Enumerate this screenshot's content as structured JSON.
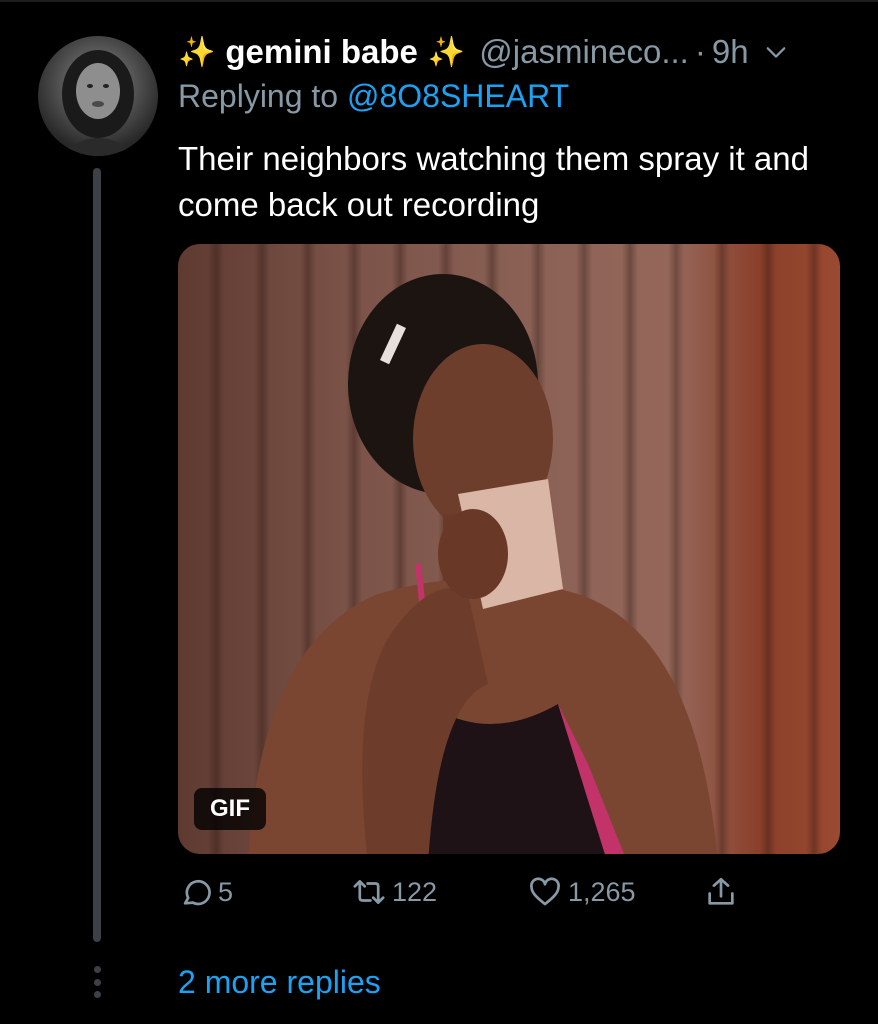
{
  "tweet": {
    "display_name": "gemini babe",
    "name_emoji_left": "✨",
    "name_emoji_right": "✨",
    "handle": "@jasmineco...",
    "separator": "·",
    "timestamp": "9h",
    "replying_prefix": "Replying to ",
    "replying_to": "@8O8SHEART",
    "text": "Their neighbors watching them spray it and come back out recording",
    "media_badge": "GIF"
  },
  "actions": {
    "replies": "5",
    "retweets": "122",
    "likes": "1,265"
  },
  "thread": {
    "more_replies": "2 more replies"
  },
  "colors": {
    "background": "#000000",
    "secondary_text": "#8899a6",
    "link": "#1da1f2",
    "thread_line": "#3c4146"
  },
  "icons": [
    "reply-icon",
    "retweet-icon",
    "like-icon",
    "share-icon",
    "chevron-down-icon",
    "more-dots-icon"
  ]
}
